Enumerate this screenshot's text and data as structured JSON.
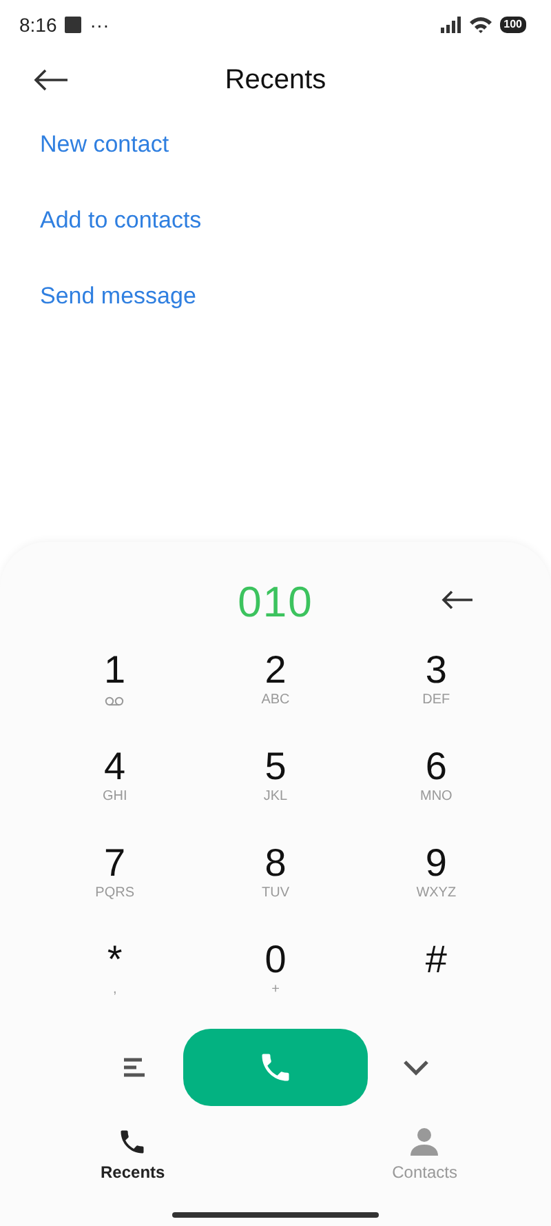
{
  "status_bar": {
    "time": "8:16",
    "dots": "···",
    "battery": "100"
  },
  "header": {
    "title": "Recents"
  },
  "actions": [
    "New contact",
    "Add to contacts",
    "Send message"
  ],
  "dialer": {
    "number": "010",
    "keys": [
      {
        "digit": "1",
        "kind": "voicemail"
      },
      {
        "digit": "2",
        "kind": "letters",
        "letters": "ABC"
      },
      {
        "digit": "3",
        "kind": "letters",
        "letters": "DEF"
      },
      {
        "digit": "4",
        "kind": "letters",
        "letters": "GHI"
      },
      {
        "digit": "5",
        "kind": "letters",
        "letters": "JKL"
      },
      {
        "digit": "6",
        "kind": "letters",
        "letters": "MNO"
      },
      {
        "digit": "7",
        "kind": "letters",
        "letters": "PQRS"
      },
      {
        "digit": "8",
        "kind": "letters",
        "letters": "TUV"
      },
      {
        "digit": "9",
        "kind": "letters",
        "letters": "WXYZ"
      },
      {
        "digit": "*",
        "kind": "letters",
        "letters": ","
      },
      {
        "digit": "0",
        "kind": "letters",
        "letters": "+"
      },
      {
        "digit": "#",
        "kind": "plain"
      }
    ]
  },
  "tabs": [
    {
      "label": "Recents",
      "kind": "phone",
      "selected": true
    },
    {
      "label": "Contacts",
      "kind": "person",
      "selected": false
    }
  ]
}
